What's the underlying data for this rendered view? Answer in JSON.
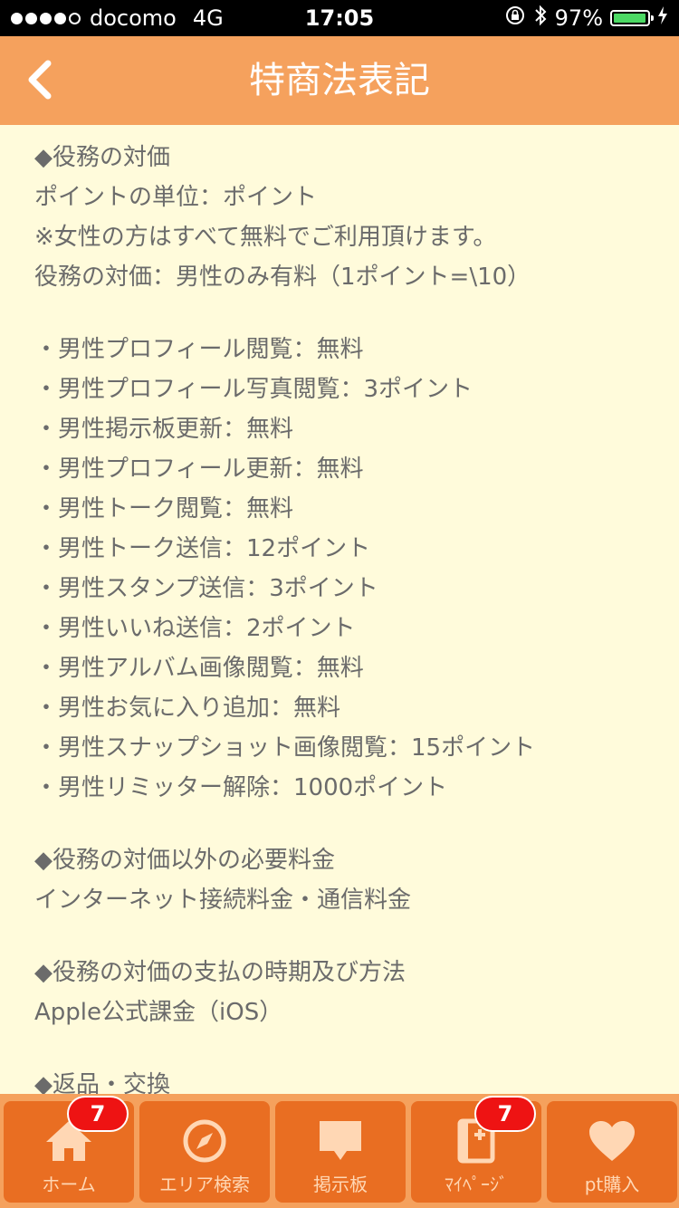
{
  "status_bar": {
    "carrier": "docomo",
    "network": "4G",
    "time": "17:05",
    "battery_percent": "97%",
    "battery_level": 0.97
  },
  "nav": {
    "title": "特商法表記",
    "back_icon": "chevron-left-icon"
  },
  "content": {
    "sections": [
      {
        "lines": [
          "◆役務の対価",
          "ポイントの単位：ポイント",
          "※女性の方はすべて無料でご利用頂けます。",
          "役務の対価：男性のみ有料（1ポイント=\\10）"
        ]
      },
      {
        "lines": [
          "・男性プロフィール閲覧：無料",
          "・男性プロフィール写真閲覧：3ポイント",
          "・男性掲示板更新：無料",
          "・男性プロフィール更新：無料",
          "・男性トーク閲覧：無料",
          "・男性トーク送信：12ポイント",
          "・男性スタンプ送信：3ポイント",
          "・男性いいね送信：2ポイント",
          "・男性アルバム画像閲覧：無料",
          "・男性お気に入り追加：無料",
          "・男性スナップショット画像閲覧：15ポイント",
          "・男性リミッター解除：1000ポイント"
        ]
      },
      {
        "lines": [
          "◆役務の対価以外の必要料金",
          "インターネット接続料金・通信料金"
        ]
      },
      {
        "lines": [
          "◆役務の対価の支払の時期及び方法",
          "Apple公式課金（iOS）"
        ]
      },
      {
        "lines": [
          "◆返品・交換"
        ]
      }
    ]
  },
  "tab_bar": {
    "tabs": [
      {
        "label": "ホーム",
        "icon": "home-icon",
        "badge": "7"
      },
      {
        "label": "エリア検索",
        "icon": "compass-icon",
        "badge": ""
      },
      {
        "label": "掲示板",
        "icon": "speech-bubble-icon",
        "badge": ""
      },
      {
        "label": "ﾏｲﾍﾟｰｼﾞ",
        "icon": "profile-book-icon",
        "badge": "7"
      },
      {
        "label": "pt購入",
        "icon": "heart-icon",
        "badge": ""
      }
    ]
  },
  "colors": {
    "nav_background": "#f5a15d",
    "tab_background": "#e96e22",
    "page_background": "#fffbdb",
    "badge": "#ee1313"
  }
}
